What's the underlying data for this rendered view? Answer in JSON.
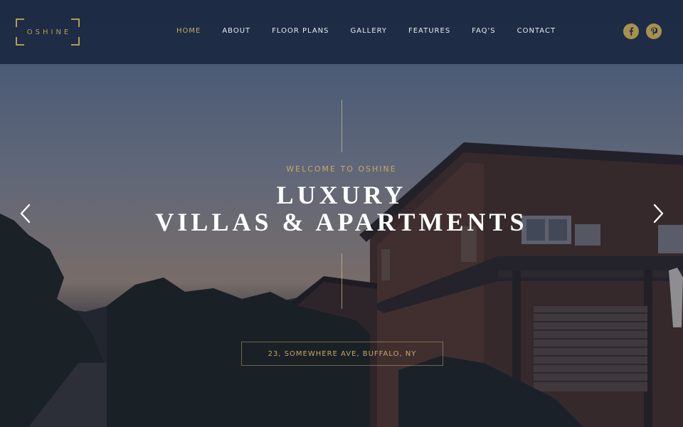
{
  "brand": {
    "logo_text": "OSHINE",
    "accent_color": "#c7a866"
  },
  "nav": {
    "items": [
      {
        "label": "HOME",
        "active": true
      },
      {
        "label": "ABOUT",
        "active": false
      },
      {
        "label": "FLOOR PLANS",
        "active": false
      },
      {
        "label": "GALLERY",
        "active": false
      },
      {
        "label": "FEATURES",
        "active": false
      },
      {
        "label": "FAQ'S",
        "active": false
      },
      {
        "label": "CONTACT",
        "active": false
      }
    ]
  },
  "social": [
    {
      "icon": "facebook-icon",
      "glyph": "f"
    },
    {
      "icon": "pinterest-icon",
      "glyph": "p"
    }
  ],
  "hero": {
    "eyebrow": "WELCOME TO OSHINE",
    "headline_line1": "LUXURY",
    "headline_line2": "VILLAS & APARTMENTS",
    "address": "23, SOMEWHERE AVE, BUFFALO, NY",
    "prev_icon": "chevron-left-icon",
    "next_icon": "chevron-right-icon"
  }
}
